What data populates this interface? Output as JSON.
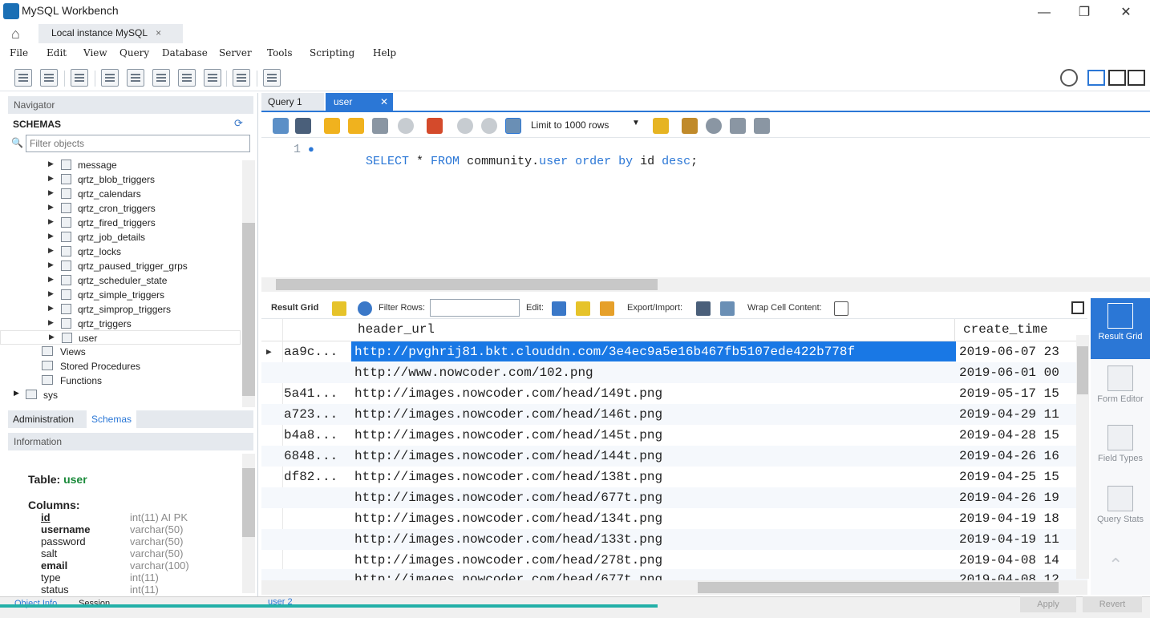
{
  "window": {
    "title": "MySQL Workbench",
    "minimize_glyph": "—",
    "maximize_glyph": "❐",
    "close_glyph": "✕"
  },
  "connection_tab": {
    "label": "Local instance MySQL",
    "close_glyph": "×"
  },
  "menu": [
    "File",
    "Edit",
    "View",
    "Query",
    "Database",
    "Server",
    "Tools",
    "Scripting",
    "Help"
  ],
  "sidebar": {
    "navigator_label": "Navigator",
    "schemas_label": "SCHEMAS",
    "filter_placeholder": "Filter objects",
    "tables": [
      "message",
      "qrtz_blob_triggers",
      "qrtz_calendars",
      "qrtz_cron_triggers",
      "qrtz_fired_triggers",
      "qrtz_job_details",
      "qrtz_locks",
      "qrtz_paused_trigger_grps",
      "qrtz_scheduler_state",
      "qrtz_simple_triggers",
      "qrtz_simprop_triggers",
      "qrtz_triggers",
      "user"
    ],
    "selected_table": "user",
    "sub_items": [
      "Views",
      "Stored Procedures",
      "Functions"
    ],
    "other_schema": "sys",
    "tabs": {
      "administration": "Administration",
      "schemas": "Schemas"
    },
    "information_label": "Information",
    "info": {
      "table_prefix": "Table:",
      "table_name": "user",
      "columns_label": "Columns:",
      "columns": [
        {
          "name": "id",
          "type": "int(11) AI PK",
          "bold": true
        },
        {
          "name": "username",
          "type": "varchar(50)",
          "bold": true
        },
        {
          "name": "password",
          "type": "varchar(50)",
          "bold": false
        },
        {
          "name": "salt",
          "type": "varchar(50)",
          "bold": false
        },
        {
          "name": "email",
          "type": "varchar(100)",
          "bold": true
        },
        {
          "name": "type",
          "type": "int(11)",
          "bold": false
        },
        {
          "name": "status",
          "type": "int(11)",
          "bold": false
        }
      ]
    },
    "bottom_tabs": {
      "object_info": "Object Info",
      "session": "Session"
    }
  },
  "query_tabs": [
    {
      "label": "Query 1",
      "active": false
    },
    {
      "label": "user",
      "active": true
    }
  ],
  "sql_toolbar": {
    "limit_label": "Limit to 1000 rows"
  },
  "editor": {
    "line_number": "1",
    "tokens": [
      {
        "text": "SELECT",
        "cls": "kw"
      },
      {
        "text": " * ",
        "cls": ""
      },
      {
        "text": "FROM",
        "cls": "kw"
      },
      {
        "text": " community.",
        "cls": ""
      },
      {
        "text": "user",
        "cls": "fn"
      },
      {
        "text": " ",
        "cls": ""
      },
      {
        "text": "order by",
        "cls": "kw"
      },
      {
        "text": " id ",
        "cls": ""
      },
      {
        "text": "desc",
        "cls": "kw"
      },
      {
        "text": ";",
        "cls": ""
      }
    ]
  },
  "result_toolbar": {
    "result_grid": "Result Grid",
    "filter_rows": "Filter Rows:",
    "edit": "Edit:",
    "export_import": "Export/Import:",
    "wrap_cell": "Wrap Cell Content:"
  },
  "grid": {
    "headers": [
      "header_url",
      "create_time"
    ],
    "rows": [
      {
        "c0": "aa9c...",
        "url": "http://pvghrij81.bkt.clouddn.com/3e4ec9a5e16b467fb5107ede422b778f",
        "time": "2019-06-07 23",
        "selected": true
      },
      {
        "c0": "",
        "url": "http://www.nowcoder.com/102.png",
        "time": "2019-06-01 00",
        "selected": false
      },
      {
        "c0": "5a41...",
        "url": "http://images.nowcoder.com/head/149t.png",
        "time": "2019-05-17 15",
        "selected": false
      },
      {
        "c0": "a723...",
        "url": "http://images.nowcoder.com/head/146t.png",
        "time": "2019-04-29 11",
        "selected": false
      },
      {
        "c0": "b4a8...",
        "url": "http://images.nowcoder.com/head/145t.png",
        "time": "2019-04-28 15",
        "selected": false
      },
      {
        "c0": "6848...",
        "url": "http://images.nowcoder.com/head/144t.png",
        "time": "2019-04-26 16",
        "selected": false
      },
      {
        "c0": "df82...",
        "url": "http://images.nowcoder.com/head/138t.png",
        "time": "2019-04-25 15",
        "selected": false
      },
      {
        "c0": "",
        "url": "http://images.nowcoder.com/head/677t.png",
        "time": "2019-04-26 19",
        "selected": false
      },
      {
        "c0": "",
        "url": "http://images.nowcoder.com/head/134t.png",
        "time": "2019-04-19 18",
        "selected": false
      },
      {
        "c0": "",
        "url": "http://images.nowcoder.com/head/133t.png",
        "time": "2019-04-19 11",
        "selected": false
      },
      {
        "c0": "",
        "url": "http://images.nowcoder.com/head/278t.png",
        "time": "2019-04-08 14",
        "selected": false
      },
      {
        "c0": "",
        "url": "http://images.nowcoder.com/head/677t.png",
        "time": "2019-04-08 12",
        "selected": false
      }
    ]
  },
  "right_panel": [
    {
      "label": "Result Grid",
      "active": true
    },
    {
      "label": "Form Editor",
      "active": false
    },
    {
      "label": "Field Types",
      "active": false
    },
    {
      "label": "Query Stats",
      "active": false
    }
  ],
  "bottom": {
    "result_tab": "user 2",
    "apply": "Apply",
    "revert": "Revert"
  },
  "colors": {
    "accent": "#2b77d6",
    "selection": "#1978e5",
    "table_name": "#1a8a3a"
  }
}
